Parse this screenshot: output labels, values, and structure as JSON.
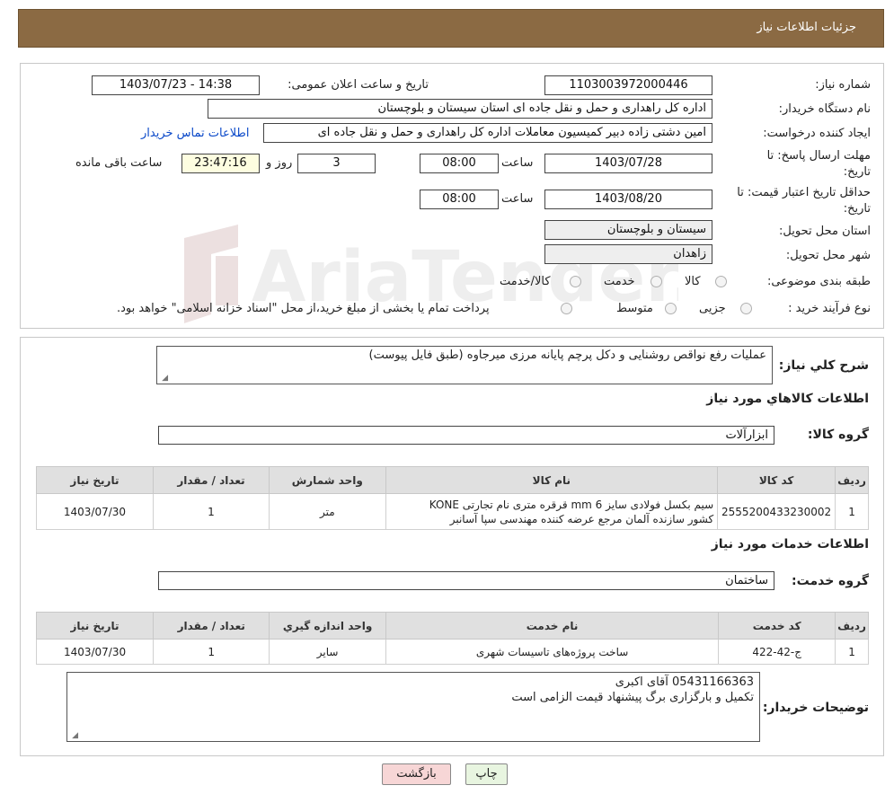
{
  "header": {
    "title": "جزئیات اطلاعات نیاز"
  },
  "form": {
    "need_number_label": "شماره نیاز:",
    "need_number": "1103003972000446",
    "announce_label": "تاریخ و ساعت اعلان عمومی:",
    "announce_value": "1403/07/23 - 14:38",
    "buyer_org_label": "نام دستگاه خریدار:",
    "buyer_org": "اداره کل راهداری و حمل و نقل جاده ای استان سیستان و بلوچستان",
    "creator_label": "ایجاد کننده درخواست:",
    "creator": "امین دشتی زاده دبیر کمیسیون معاملات اداره کل راهداری و حمل و نقل جاده ای",
    "contact_link": "اطلاعات تماس خریدار",
    "deadline_label_1": "مهلت ارسال پاسخ: تا",
    "deadline_label_2": "تاریخ:",
    "deadline_date": "1403/07/28",
    "time_label": "ساعت",
    "deadline_time": "08:00",
    "days": "3",
    "days_label": "روز و",
    "remaining_time": "23:47:16",
    "remaining_label": "ساعت باقی مانده",
    "validity_label_1": "حداقل تاریخ اعتبار قیمت: تا",
    "validity_label_2": "تاریخ:",
    "validity_date": "1403/08/20",
    "validity_time": "08:00",
    "province_label": "استان محل تحویل:",
    "province": "سیستان و بلوچستان",
    "city_label": "شهر محل تحویل:",
    "city": "زاهدان",
    "category_label": "طبقه بندی موضوعی:",
    "category_options": [
      "کالا",
      "خدمت",
      "کالا/خدمت"
    ],
    "process_label": "نوع فرآیند خرید :",
    "process_options": [
      "جزیی",
      "متوسط"
    ],
    "process_note": "پرداخت تمام یا بخشی از مبلغ خرید،از محل \"اسناد خزانه اسلامی\" خواهد بود."
  },
  "description": {
    "label": "شرح کلي نياز:",
    "text": "عملیات رفع نواقص روشنایی و دکل پرچم پایانه مرزی میرجاوه (طبق فایل پیوست)"
  },
  "goods": {
    "section_title": "اطلاعات کالاهاي مورد نياز",
    "group_label": "گروه کالا:",
    "group": "ابزارآلات",
    "headers": [
      "رديف",
      "کد کالا",
      "نام کالا",
      "واحد شمارش",
      "تعداد / مقدار",
      "تاريخ نياز"
    ],
    "rows": [
      {
        "row": "1",
        "code": "2555200433230002",
        "name_line1": "سیم بکسل فولادی سایز 6 mm قرقره متری نام تجارتی KONE",
        "name_line2": "کشور سازنده آلمان مرجع عرضه کننده مهندسی سپا آسانبر",
        "unit": "متر",
        "qty": "1",
        "date": "1403/07/30"
      }
    ]
  },
  "services": {
    "section_title": "اطلاعات خدمات مورد نياز",
    "group_label": "گروه خدمت:",
    "group": "ساختمان",
    "headers": [
      "رديف",
      "کد خدمت",
      "نام خدمت",
      "واحد اندازه گيري",
      "تعداد / مقدار",
      "تاريخ نياز"
    ],
    "rows": [
      {
        "row": "1",
        "code": "ج-42-422",
        "name": "ساخت پروژه‌های تاسیسات شهری",
        "unit": "سایر",
        "qty": "1",
        "date": "1403/07/30"
      }
    ]
  },
  "buyer_notes": {
    "label": "توضيحات خريدار:",
    "line1": "05431166363 آقای اکبری",
    "line2": "تکمیل و بارگزاری برگ پیشنهاد قیمت الزامی است"
  },
  "buttons": {
    "print": "چاپ",
    "back": "بازگشت"
  },
  "watermark": {
    "text": "AriaTender.neT"
  },
  "colors": {
    "header_bg": "#8b6a43",
    "link": "#0b49c9",
    "back_button_bg": "#f7d6d6",
    "print_button_bg": "#e8f5e0"
  }
}
